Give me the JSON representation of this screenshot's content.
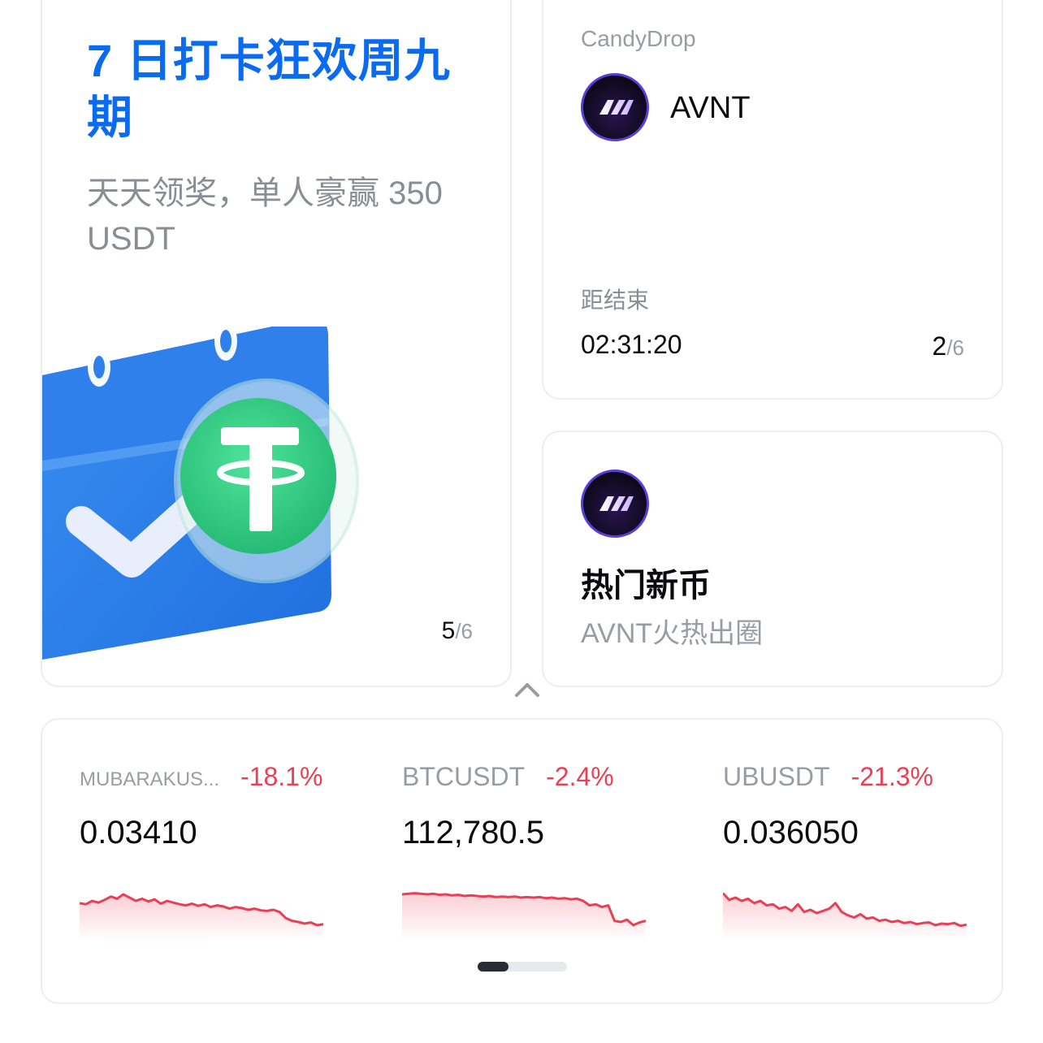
{
  "promo": {
    "title": "7 日打卡狂欢周九期",
    "subtitle": "天天领奖，单人豪赢 350 USDT",
    "pager_current": "5",
    "pager_total": "/6"
  },
  "candydrop": {
    "label": "CandyDrop",
    "token": "AVNT",
    "ends_label": "距结束",
    "countdown": "02:31:20",
    "pager_current": "2",
    "pager_total": "/6"
  },
  "hot_coin": {
    "title": "热门新币",
    "description": "AVNT火热出圈"
  },
  "market": {
    "tickers": [
      {
        "symbol": "MUBARAKUS...",
        "change": "-18.1%",
        "price": "0.03410",
        "spark": [
          0.62,
          0.6,
          0.66,
          0.63,
          0.68,
          0.74,
          0.7,
          0.78,
          0.72,
          0.66,
          0.7,
          0.65,
          0.69,
          0.61,
          0.66,
          0.63,
          0.6,
          0.58,
          0.61,
          0.57,
          0.6,
          0.55,
          0.58,
          0.56,
          0.52,
          0.55,
          0.53,
          0.5,
          0.52,
          0.49,
          0.48,
          0.5,
          0.46,
          0.35,
          0.3,
          0.28,
          0.25,
          0.27,
          0.22,
          0.24
        ]
      },
      {
        "symbol": "BTCUSDT",
        "change": "-2.4%",
        "price": "112,780.5",
        "spark": [
          0.78,
          0.79,
          0.8,
          0.79,
          0.78,
          0.79,
          0.77,
          0.78,
          0.76,
          0.77,
          0.75,
          0.76,
          0.75,
          0.74,
          0.75,
          0.73,
          0.74,
          0.73,
          0.74,
          0.72,
          0.73,
          0.72,
          0.73,
          0.71,
          0.72,
          0.7,
          0.71,
          0.69,
          0.7,
          0.66,
          0.58,
          0.6,
          0.55,
          0.58,
          0.3,
          0.28,
          0.32,
          0.22,
          0.27,
          0.3
        ]
      },
      {
        "symbol": "UBUSDT",
        "change": "-21.3%",
        "price": "0.036050",
        "spark": [
          0.8,
          0.68,
          0.72,
          0.66,
          0.7,
          0.62,
          0.66,
          0.58,
          0.6,
          0.52,
          0.55,
          0.48,
          0.6,
          0.46,
          0.5,
          0.44,
          0.48,
          0.52,
          0.62,
          0.46,
          0.4,
          0.36,
          0.42,
          0.34,
          0.36,
          0.3,
          0.32,
          0.28,
          0.3,
          0.26,
          0.28,
          0.24,
          0.26,
          0.27,
          0.22,
          0.25,
          0.24,
          0.26,
          0.21,
          0.23
        ]
      }
    ]
  }
}
